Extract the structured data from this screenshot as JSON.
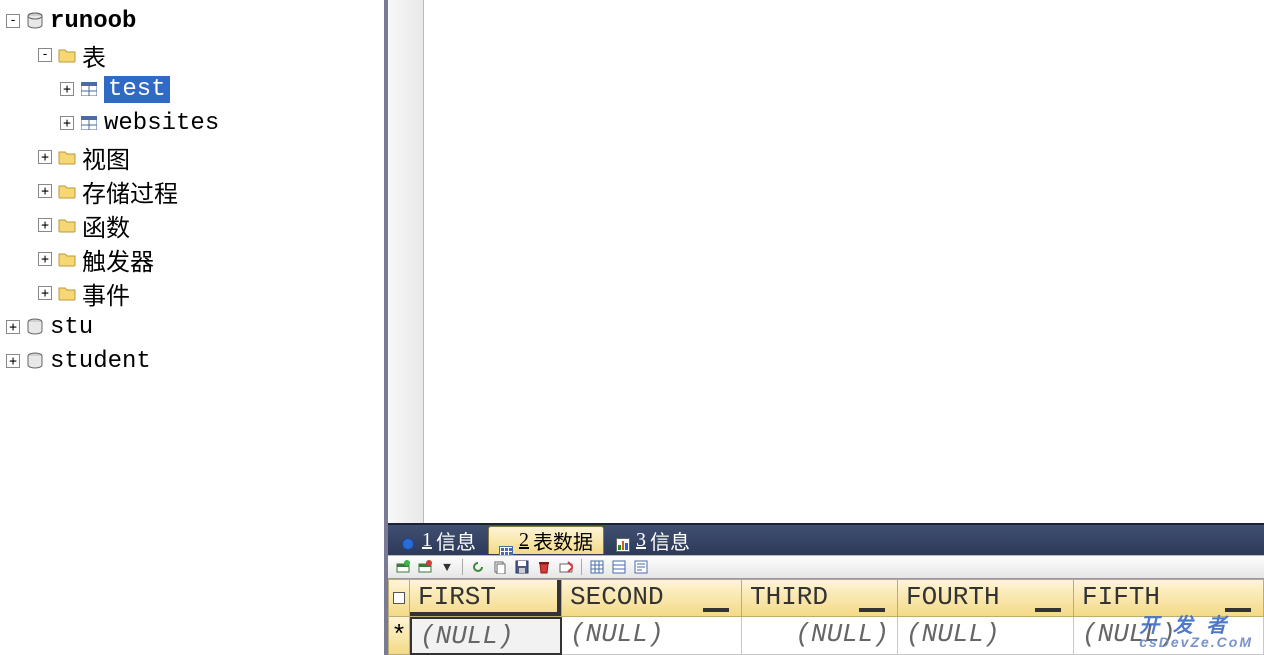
{
  "tree": {
    "db_runoob": "runoob",
    "tables_folder": "表",
    "table_test": "test",
    "table_websites": "websites",
    "views_folder": "视图",
    "procs_folder": "存储过程",
    "funcs_folder": "函数",
    "triggers_folder": "触发器",
    "events_folder": "事件",
    "db_stu": "stu",
    "db_student": "student"
  },
  "tabs": {
    "t1_num": "1",
    "t1_label": "信息",
    "t2_num": "2",
    "t2_label": "表数据",
    "t3_num": "3",
    "t3_label": "信息"
  },
  "grid": {
    "row_marker": "*",
    "headers": {
      "c1": "FIRST",
      "c2": "SECOND",
      "c3": "THIRD",
      "c4": "FOURTH",
      "c5": "FIFTH"
    },
    "row1": {
      "c1": "(NULL)",
      "c2": "(NULL)",
      "c3": "(NULL)",
      "c4": "(NULL)",
      "c5": "(NULL)"
    }
  },
  "watermark": {
    "main": "开 发 者",
    "sub": "csDevZe.CoM"
  }
}
